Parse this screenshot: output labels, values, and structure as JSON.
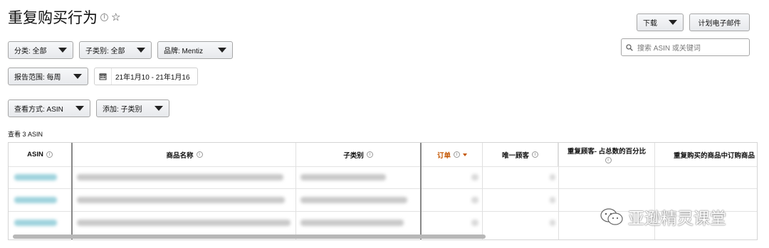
{
  "page": {
    "title": "重复购买行为",
    "info_glyph": "i",
    "star_glyph": "☆"
  },
  "toolbar": {
    "download_label": "下载",
    "email_label": "计划电子邮件",
    "search_placeholder": "搜索 ASIN 或关键词"
  },
  "filters": {
    "category": "分类: 全部",
    "subcategory": "子类别: 全部",
    "brand": "品牌: Mentiz",
    "report_range": "报告范围: 每周",
    "date_range": "21年1月10 - 21年1月16",
    "view_by": "查看方式: ASIN",
    "add": "添加: 子类别"
  },
  "table": {
    "count_label": "查看 3 ASIN",
    "columns": [
      {
        "label": "ASIN"
      },
      {
        "label": "商品名称"
      },
      {
        "label": "子类别"
      },
      {
        "label": "订单"
      },
      {
        "label": "唯一顾客"
      },
      {
        "label": "重复顾客- 占总数的百分比"
      },
      {
        "label": "重复购买的商品中订购商品"
      }
    ],
    "sorted_column": "订单",
    "row_count": 3
  },
  "watermark": {
    "text": "亚逊精灵课堂",
    "icon": "wechat-icon"
  },
  "colors": {
    "sorted_header": "#c45500",
    "asin_link": "#9fd3dd"
  }
}
